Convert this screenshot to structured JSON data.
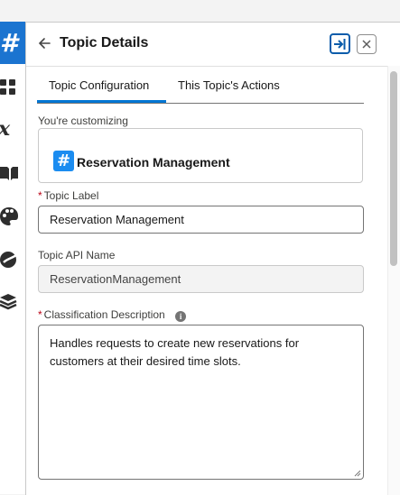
{
  "rail": {
    "active_glyph": "#",
    "icons": [
      "topic-icon",
      "apps-grid-icon",
      "variable-icon",
      "library-icon",
      "palette-icon",
      "knowledge-icon",
      "layers-icon"
    ]
  },
  "header": {
    "title": "Topic Details",
    "icons": [
      "back-arrow-icon",
      "collapse-panel-icon",
      "close-icon"
    ]
  },
  "tabs": [
    {
      "label": "Topic Configuration",
      "selected": true
    },
    {
      "label": "This Topic's Actions",
      "selected": false
    }
  ],
  "customizing": {
    "label": "You're customizing",
    "topic_name": "Reservation Management",
    "icon": "#"
  },
  "fields": {
    "topic_label": {
      "label": "Topic Label",
      "required": "*",
      "value": "Reservation Management"
    },
    "api_name": {
      "label": "Topic API Name",
      "value": "ReservationManagement"
    },
    "description": {
      "label": "Classification Description",
      "required": "*",
      "info_glyph": "i",
      "value": "Handles requests to create new reservations for customers at their desired time slots."
    }
  },
  "colors": {
    "accent": "#0176d3",
    "rail_active": "#1b74d0",
    "required": "#ba0517"
  }
}
